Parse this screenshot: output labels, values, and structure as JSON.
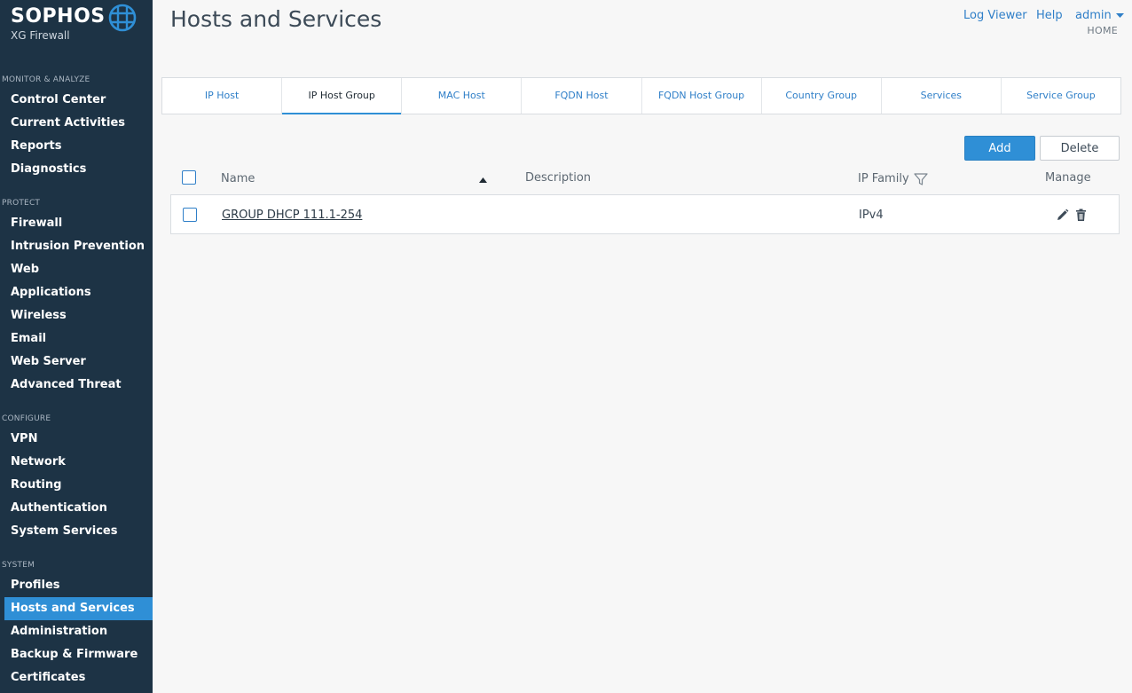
{
  "brand": {
    "name": "SOPHOS",
    "product": "XG Firewall",
    "accent": "#2f8fd6"
  },
  "sidebar": {
    "sections": [
      {
        "title": "MONITOR & ANALYZE",
        "items": [
          "Control Center",
          "Current Activities",
          "Reports",
          "Diagnostics"
        ]
      },
      {
        "title": "PROTECT",
        "items": [
          "Firewall",
          "Intrusion Prevention",
          "Web",
          "Applications",
          "Wireless",
          "Email",
          "Web Server",
          "Advanced Threat"
        ]
      },
      {
        "title": "CONFIGURE",
        "items": [
          "VPN",
          "Network",
          "Routing",
          "Authentication",
          "System Services"
        ]
      },
      {
        "title": "SYSTEM",
        "items": [
          "Profiles",
          "Hosts and Services",
          "Administration",
          "Backup & Firmware",
          "Certificates"
        ]
      }
    ],
    "active_item": "Hosts and Services"
  },
  "header": {
    "title": "Hosts and Services",
    "links": {
      "log_viewer": "Log Viewer",
      "help": "Help",
      "admin": "admin"
    },
    "breadcrumb": "HOME"
  },
  "tabs": [
    "IP Host",
    "IP Host Group",
    "MAC Host",
    "FQDN Host",
    "FQDN Host Group",
    "Country Group",
    "Services",
    "Service Group"
  ],
  "active_tab": "IP Host Group",
  "toolbar": {
    "add_label": "Add",
    "delete_label": "Delete"
  },
  "table": {
    "columns": {
      "name": "Name",
      "description": "Description",
      "ip_family": "IP Family",
      "manage": "Manage"
    },
    "rows": [
      {
        "name": "GROUP DHCP 111.1-254",
        "description": "",
        "ip_family": "IPv4"
      }
    ]
  }
}
